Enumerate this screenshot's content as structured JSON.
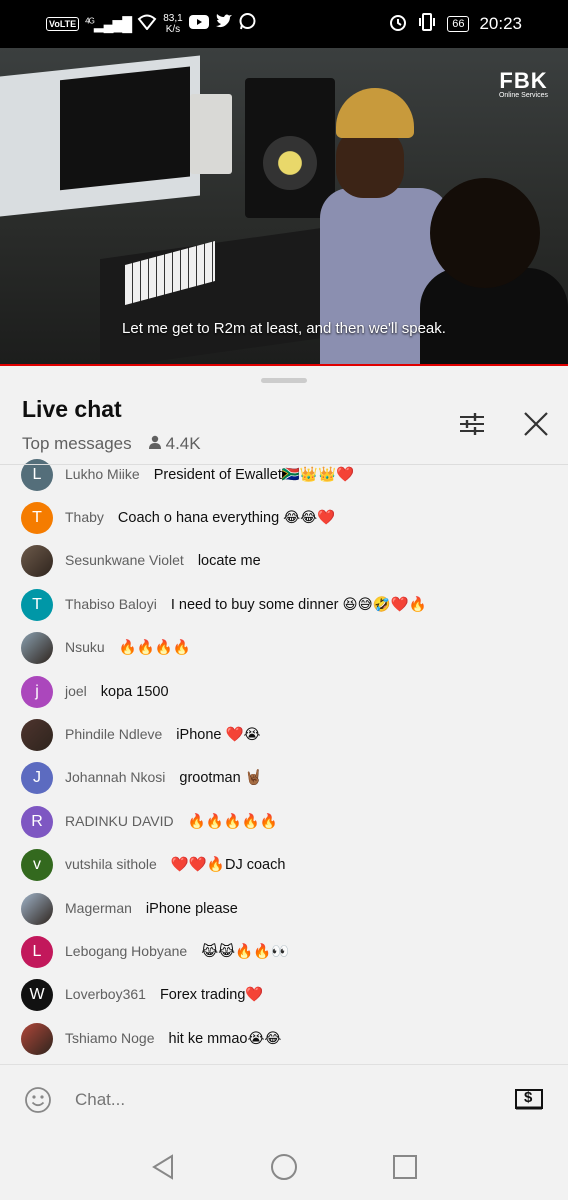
{
  "status_bar": {
    "volte": "VoLTE",
    "network": "4G",
    "speed_value": "83,1",
    "speed_unit": "K/s",
    "battery": "66",
    "time": "20:23",
    "icons": [
      "youtube-icon",
      "twitter-icon",
      "whatsapp-icon",
      "alarm-icon",
      "vibrate-icon"
    ]
  },
  "video": {
    "channel_logo": "FBK",
    "channel_logo_sub": "Online Services",
    "caption": "Let me get to R2m at least, and then we'll speak.",
    "progress": 1.0,
    "progress_color": "#e00000"
  },
  "chat": {
    "title": "Live chat",
    "mode": "Top messages",
    "viewers": "4.4K",
    "icons": [
      "filter-icon",
      "close-icon",
      "person-icon"
    ],
    "messages": [
      {
        "author": "Lukho Miike",
        "text": "President of Ewallet🇿🇦👑👑❤️",
        "avatar_letter": "L",
        "avatar_color": "#546e7a"
      },
      {
        "author": "Thaby",
        "text": "Coach o hana everything 😂😂❤️",
        "avatar_letter": "T",
        "avatar_color": "#f57c00"
      },
      {
        "author": "Sesunkwane Violet",
        "text": "locate me",
        "avatar_letter": "",
        "avatar_color": "#6d5a4b"
      },
      {
        "author": "Thabiso Baloyi",
        "text": "I need to buy some dinner 😆😅🤣❤️🔥",
        "avatar_letter": "T",
        "avatar_color": "#0097a7"
      },
      {
        "author": "Nsuku",
        "text": "🔥🔥🔥🔥",
        "avatar_letter": "",
        "avatar_color": "#8aa0b0"
      },
      {
        "author": "joel",
        "text": "kopa 1500",
        "avatar_letter": "j",
        "avatar_color": "#ab47bc"
      },
      {
        "author": "Phindile Ndleve",
        "text": "iPhone ❤️😭",
        "avatar_letter": "",
        "avatar_color": "#4e342e"
      },
      {
        "author": "Johannah Nkosi",
        "text": "grootman 🤘🏾",
        "avatar_letter": "J",
        "avatar_color": "#5c6bc0"
      },
      {
        "author": "RADINKU DAVID",
        "text": "🔥🔥🔥🔥🔥",
        "avatar_letter": "R",
        "avatar_color": "#7e57c2"
      },
      {
        "author": "vutshila sithole",
        "text": "❤️❤️🔥DJ coach",
        "avatar_letter": "v",
        "avatar_color": "#33691e"
      },
      {
        "author": "Magerman",
        "text": "iPhone please",
        "avatar_letter": "",
        "avatar_color": "#9fb3c8"
      },
      {
        "author": "Lebogang Hobyane",
        "text": "😹😹🔥🔥👀",
        "avatar_letter": "L",
        "avatar_color": "#c2185b"
      },
      {
        "author": "Loverboy361",
        "text": "Forex trading❤️",
        "avatar_letter": "W",
        "avatar_color": "#111111"
      },
      {
        "author": "Tshiamo Noge",
        "text": "hit ke mmao😭😂",
        "avatar_letter": "",
        "avatar_color": "#b0473a"
      }
    ]
  },
  "input": {
    "placeholder": "Chat...",
    "superchat_symbol": "$"
  },
  "nav": {
    "icons": [
      "back-icon",
      "home-icon",
      "recents-icon"
    ]
  }
}
